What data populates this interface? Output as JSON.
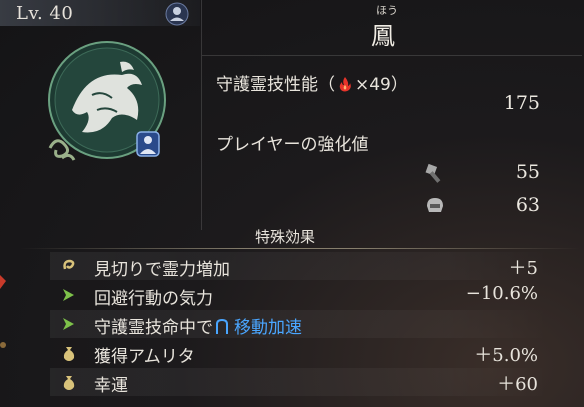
{
  "header": {
    "level": "Lv. 40"
  },
  "spirit": {
    "furigana": "ほう",
    "name": "鳳"
  },
  "stats": {
    "skill_label_pre": "守護霊技性能（",
    "skill_label_post": "×49）",
    "skill_value": "175",
    "player_label": "プレイヤーの強化値",
    "player_values": [
      "55",
      "63"
    ]
  },
  "effects": {
    "title": "特殊効果",
    "items": [
      {
        "label": "見切りで霊力増加",
        "value": "＋5",
        "icon": "ki-icon"
      },
      {
        "label": "回避行動の気力",
        "value": "−10.6%",
        "icon": "arrow-icon"
      },
      {
        "label_pre": "守護霊技命中で",
        "label_accent": "移動加速",
        "value": "",
        "icon": "arrow-icon"
      },
      {
        "label": "獲得アムリタ",
        "value": "＋5.0%",
        "icon": "pouch-icon"
      },
      {
        "label": "幸運",
        "value": "＋60",
        "icon": "pouch-icon"
      }
    ]
  },
  "colors": {
    "accent": "#4aa6ff",
    "flame": "#e8342a",
    "green_icon": "#7ec24a",
    "gold_icon": "#d8c27a"
  }
}
